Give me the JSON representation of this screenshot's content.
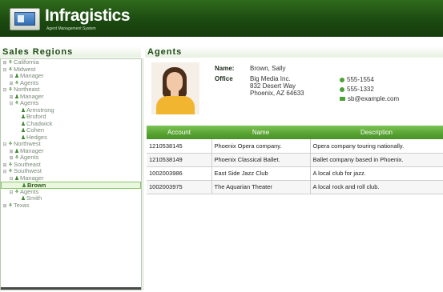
{
  "header": {
    "title": "Infragistics",
    "subtitle": "Agent Management System",
    "logo_icon": "monitor-logo-icon"
  },
  "left_panel": {
    "title": "Sales Regions"
  },
  "right_panel": {
    "title": "Agents"
  },
  "tree": [
    {
      "label": "California",
      "indent": 0,
      "expander": "+",
      "icon": "people-icon",
      "selected": false
    },
    {
      "label": "Midwest",
      "indent": 0,
      "expander": "-",
      "icon": "people-icon",
      "selected": false
    },
    {
      "label": "Manager",
      "indent": 1,
      "expander": "+",
      "icon": "person-icon",
      "selected": false
    },
    {
      "label": "Agents",
      "indent": 1,
      "expander": "+",
      "icon": "people-icon",
      "selected": false
    },
    {
      "label": "Northeast",
      "indent": 0,
      "expander": "-",
      "icon": "people-icon",
      "selected": false
    },
    {
      "label": "Manager",
      "indent": 1,
      "expander": "+",
      "icon": "person-icon",
      "selected": false
    },
    {
      "label": "Agents",
      "indent": 1,
      "expander": "-",
      "icon": "people-icon",
      "selected": false
    },
    {
      "label": "Armstrong",
      "indent": 2,
      "expander": "",
      "icon": "person-icon",
      "selected": false
    },
    {
      "label": "Bruford",
      "indent": 2,
      "expander": "",
      "icon": "person-icon",
      "selected": false
    },
    {
      "label": "Chadwick",
      "indent": 2,
      "expander": "",
      "icon": "person-icon",
      "selected": false
    },
    {
      "label": "Cohen",
      "indent": 2,
      "expander": "",
      "icon": "person-icon",
      "selected": false
    },
    {
      "label": "Hedges",
      "indent": 2,
      "expander": "",
      "icon": "person-icon",
      "selected": false
    },
    {
      "label": "Northwest",
      "indent": 0,
      "expander": "-",
      "icon": "people-icon",
      "selected": false
    },
    {
      "label": "Manager",
      "indent": 1,
      "expander": "+",
      "icon": "person-icon",
      "selected": false
    },
    {
      "label": "Agents",
      "indent": 1,
      "expander": "+",
      "icon": "people-icon",
      "selected": false
    },
    {
      "label": "Southeast",
      "indent": 0,
      "expander": "+",
      "icon": "people-icon",
      "selected": false
    },
    {
      "label": "Southwest",
      "indent": 0,
      "expander": "-",
      "icon": "people-icon",
      "selected": false
    },
    {
      "label": "Manager",
      "indent": 1,
      "expander": "-",
      "icon": "person-icon",
      "selected": false
    },
    {
      "label": "Brown",
      "indent": 2,
      "expander": "",
      "icon": "person-icon",
      "selected": true
    },
    {
      "label": "Agents",
      "indent": 1,
      "expander": "-",
      "icon": "people-icon",
      "selected": false
    },
    {
      "label": "Smith",
      "indent": 2,
      "expander": "",
      "icon": "person-icon",
      "selected": false
    },
    {
      "label": "Texas",
      "indent": 0,
      "expander": "+",
      "icon": "people-icon",
      "selected": false
    }
  ],
  "agent": {
    "name_label": "Name:",
    "name": "Brown, Sally",
    "office_label": "Office",
    "office_line1": "Big Media Inc.",
    "office_line2": "832 Desert Way",
    "office_line3": "Phoenix, AZ  64633",
    "phone1": "555-1554",
    "phone2": "555-1332",
    "email": "sb@example.com"
  },
  "grid": {
    "columns": [
      "Account",
      "Name",
      "Description"
    ],
    "rows": [
      [
        "1210538145",
        "Phoenix Opera company.",
        "Opera company touring nationally."
      ],
      [
        "1210538149",
        "Phoenix Classical Ballet.",
        "Ballet company based in Phoenix."
      ],
      [
        "1002003986",
        "East Side Jazz Club",
        "A local club for jazz."
      ],
      [
        "1002003975",
        "The Aquarian Theater",
        "A local rock and roll club."
      ]
    ]
  },
  "colors": {
    "header": "#1b4810",
    "accent": "#57a232",
    "selected_bg": "#e9f7dc"
  }
}
